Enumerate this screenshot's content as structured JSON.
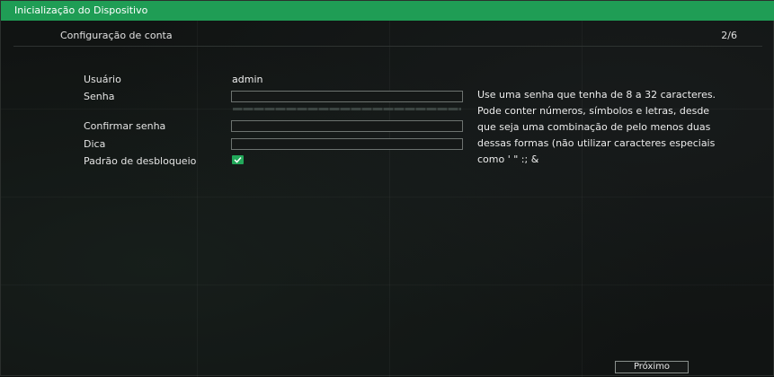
{
  "window": {
    "title": "Inicialização do Dispositivo"
  },
  "header": {
    "section": "Configuração de conta",
    "step": "2/6"
  },
  "form": {
    "user_label": "Usuário",
    "user_value": "admin",
    "password_label": "Senha",
    "password_value": "",
    "confirm_label": "Confirmar senha",
    "confirm_value": "",
    "hint_label": "Dica",
    "hint_value": "",
    "unlock_pattern_label": "Padrão de desbloqueio",
    "unlock_pattern_checked": true
  },
  "help_text": [
    "Use uma senha que tenha de 8 a 32 caracteres.",
    "Pode conter números, símbolos e letras, desde",
    "que seja uma combinação de pelo menos duas",
    "dessas formas (não utilizar caracteres especiais",
    "como ' \" :; &"
  ],
  "footer": {
    "next_label": "Próximo"
  },
  "colors": {
    "accent": "#1f9d55",
    "background": "#111413"
  }
}
